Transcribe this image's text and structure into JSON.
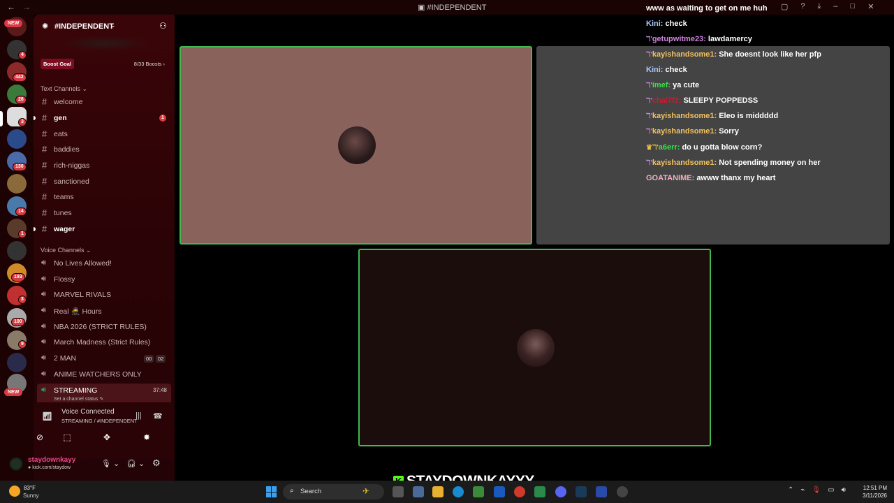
{
  "window": {
    "title": "#INDEPENDENT",
    "back": "←",
    "forward": "→"
  },
  "rail": {
    "new_label": "NEW",
    "badges": [
      "4",
      "442",
      "28",
      "3",
      "130",
      "14",
      "1",
      "193",
      "3",
      "100",
      "9"
    ],
    "top_badge_text": "NEW"
  },
  "server": {
    "name": "#INDEPENDENT",
    "boost_goal": "Boost Goal",
    "boost_count": "8/33 Boosts ›",
    "text_channels_label": "Text Channels",
    "voice_channels_label": "Voice Channels"
  },
  "text_channels": [
    {
      "name": "welcome"
    },
    {
      "name": "gen",
      "unread": "1"
    },
    {
      "name": "eats"
    },
    {
      "name": "baddies"
    },
    {
      "name": "rich-niggas"
    },
    {
      "name": "sanctioned"
    },
    {
      "name": "teams"
    },
    {
      "name": "tunes"
    },
    {
      "name": "wager"
    }
  ],
  "voice_channels": [
    {
      "name": "No Lives Allowed!"
    },
    {
      "name": "Flossy"
    },
    {
      "name": "MARVEL RIVALS"
    },
    {
      "name": "Real 🥷 Hours"
    },
    {
      "name": "NBA 2026 (STRICT RULES)"
    },
    {
      "name": "March Madness (Strict Rules)"
    },
    {
      "name": "2 MAN",
      "pill_a": "00",
      "pill_b": "02"
    },
    {
      "name": "ANIME WATCHERS ONLY"
    }
  ],
  "streaming_channel": {
    "name": "STREAMING",
    "time": "37:48",
    "status": "Set a channel status"
  },
  "voice_status": {
    "title": "Voice Connected",
    "subtitle": "STREAMING / #INDEPENDENT"
  },
  "user": {
    "name": "staydownkayy",
    "subtitle": "kick.com/staydow"
  },
  "chat": [
    {
      "user": "",
      "text": "www as waiting to get on me huh",
      "color": "#ffffff"
    },
    {
      "user": "Kini:",
      "text": "check",
      "color": "#a8c8ff"
    },
    {
      "user": "getupwitme23:",
      "text": "lawdamercy",
      "color": "#d084e0"
    },
    {
      "user": "kayishandsome1:",
      "text": "She doesnt look like her pfp",
      "color": "#f0c060"
    },
    {
      "user": "Kini:",
      "text": "check",
      "color": "#a8c8ff"
    },
    {
      "user": "imef:",
      "text": "ya cute",
      "color": "#3be04a"
    },
    {
      "user": "chai7f2:",
      "text": "SLEEPY POPPEDSS",
      "color": "#d01830"
    },
    {
      "user": "kayishandsome1:",
      "text": "Eleo is middddd",
      "color": "#f0c060"
    },
    {
      "user": "kayishandsome1:",
      "text": "Sorry",
      "color": "#f0c060"
    },
    {
      "user": "a6err:",
      "text": "do u gotta blow corn?",
      "color": "#3be04a"
    },
    {
      "user": "kayishandsome1:",
      "text": "Not spending money on her",
      "color": "#f0c060"
    },
    {
      "user": "GOATANIME:",
      "text": "awww thanx my heart",
      "color": "#f0b0c0"
    }
  ],
  "streamer_overlay": "STAYDOWNKAYYY",
  "taskbar": {
    "weather_temp": "83°F",
    "weather_cond": "Sunny",
    "search_label": "Search",
    "time": "12:51 PM",
    "date": "3/11/2026"
  }
}
